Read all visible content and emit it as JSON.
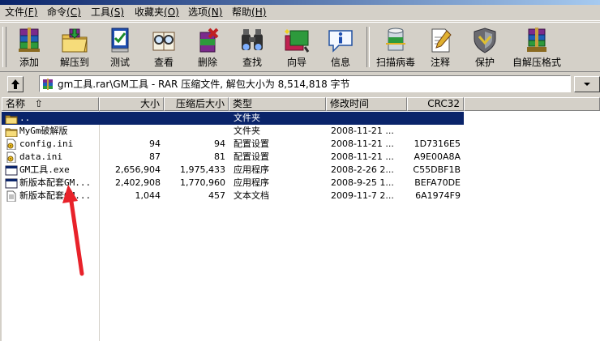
{
  "menu": [
    {
      "label": "文件",
      "key": "(F)"
    },
    {
      "label": "命令",
      "key": "(C)"
    },
    {
      "label": "工具",
      "key": "(S)"
    },
    {
      "label": "收藏夹",
      "key": "(O)"
    },
    {
      "label": "选项",
      "key": "(N)"
    },
    {
      "label": "帮助",
      "key": "(H)"
    }
  ],
  "toolbar": {
    "add": "添加",
    "extract_to": "解压到",
    "test": "测试",
    "view": "查看",
    "delete": "删除",
    "find": "查找",
    "wizard": "向导",
    "info": "信息",
    "virus_scan": "扫描病毒",
    "comment": "注释",
    "protect": "保护",
    "sfx": "自解压格式"
  },
  "address": {
    "path": "gm工具.rar\\GM工具 - RAR 压缩文件, 解包大小为 8,514,818 字节"
  },
  "columns": {
    "name": "名称",
    "size": "大小",
    "packed": "压缩后大小",
    "type": "类型",
    "modified": "修改时间",
    "crc": "CRC32"
  },
  "files": [
    {
      "name": "..",
      "size": "",
      "packed": "",
      "type": "文件夹",
      "modified": "",
      "crc": "",
      "icon": "folder-up-icon",
      "selected": true
    },
    {
      "name": "MyGm破解版",
      "size": "",
      "packed": "",
      "type": "文件夹",
      "modified": "2008-11-21 ...",
      "crc": "",
      "icon": "folder-icon",
      "selected": false
    },
    {
      "name": "config.ini",
      "size": "94",
      "packed": "94",
      "type": "配置设置",
      "modified": "2008-11-21 ...",
      "crc": "1D7316E5",
      "icon": "ini-file-icon",
      "selected": false
    },
    {
      "name": "data.ini",
      "size": "87",
      "packed": "81",
      "type": "配置设置",
      "modified": "2008-11-21 ...",
      "crc": "A9E00A8A",
      "icon": "ini-file-icon",
      "selected": false
    },
    {
      "name": "GM工具.exe",
      "size": "2,656,904",
      "packed": "1,975,433",
      "type": "应用程序",
      "modified": "2008-2-26 2...",
      "crc": "C55DBF1B",
      "icon": "exe-file-icon",
      "selected": false
    },
    {
      "name": "新版本配套GM...",
      "size": "2,402,908",
      "packed": "1,770,960",
      "type": "应用程序",
      "modified": "2008-9-25 1...",
      "crc": "BEFA70DE",
      "icon": "exe-file-icon",
      "selected": false
    },
    {
      "name": "新版本配套GM...",
      "size": "1,044",
      "packed": "457",
      "type": "文本文档",
      "modified": "2009-11-7 2...",
      "crc": "6A1974F9",
      "icon": "txt-file-icon",
      "selected": false
    }
  ],
  "colors": {
    "accent": "#0a246a",
    "window_bg": "#d4d0c8",
    "annotation_arrow": "#e8222a"
  }
}
